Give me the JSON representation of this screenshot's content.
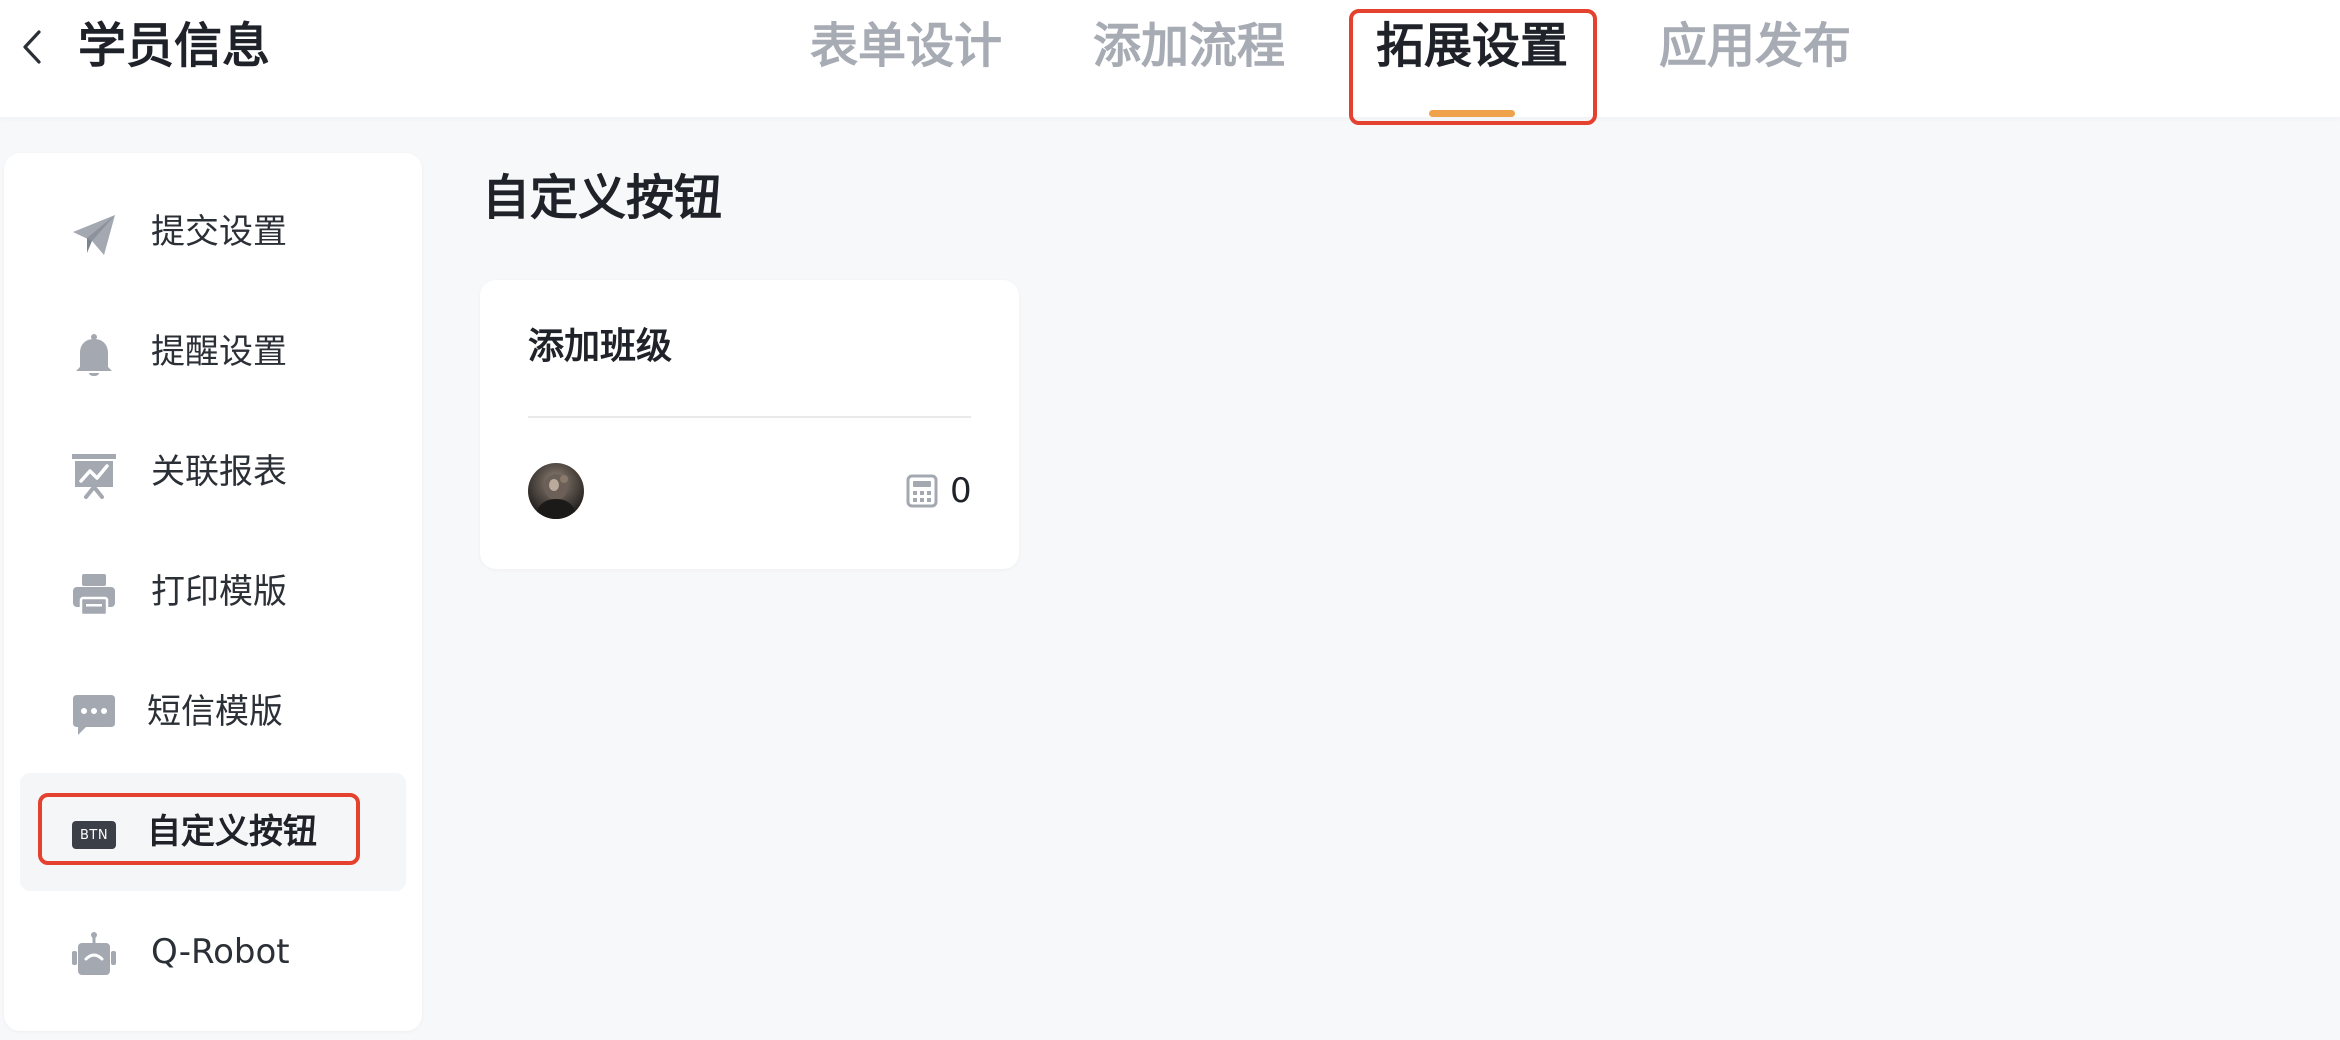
{
  "header": {
    "title": "学员信息",
    "tabs": [
      {
        "label": "表单设计"
      },
      {
        "label": "添加流程"
      },
      {
        "label": "拓展设置"
      },
      {
        "label": "应用发布"
      }
    ],
    "active_tab": "拓展设置",
    "accent_color": "#f0a24a",
    "highlight_color": "#e5412f"
  },
  "sidebar": {
    "items": [
      {
        "label": "提交设置",
        "icon": "paper-plane-icon"
      },
      {
        "label": "提醒设置",
        "icon": "bell-icon"
      },
      {
        "label": "关联报表",
        "icon": "report-board-icon"
      },
      {
        "label": "打印模版",
        "icon": "printer-icon"
      },
      {
        "label": "短信模版",
        "icon": "message-icon"
      },
      {
        "label": "自定义按钮",
        "icon": "btn-badge-icon",
        "badge": "BTN"
      },
      {
        "label": "Q-Robot",
        "icon": "robot-icon"
      }
    ],
    "active_item": "自定义按钮"
  },
  "main": {
    "section_title": "自定义按钮",
    "cards": [
      {
        "title": "添加班级",
        "count": "0",
        "count_icon": "calculator-icon"
      }
    ]
  }
}
